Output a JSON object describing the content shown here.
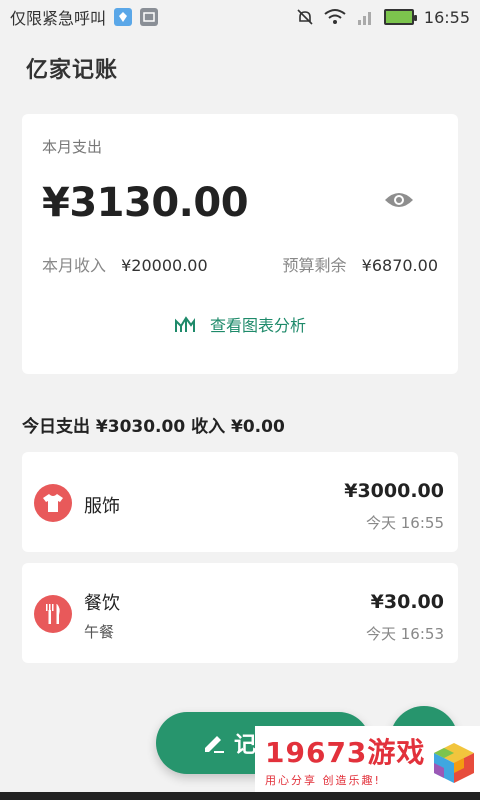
{
  "status_bar": {
    "notification_text": "仅限紧急呼叫",
    "time": "16:55"
  },
  "app_bar": {
    "title": "亿家记账"
  },
  "summary": {
    "month_expense_label": "本月支出",
    "month_expense_amount": "¥3130.00",
    "month_income_label": "本月收入",
    "month_income_amount": "¥20000.00",
    "budget_left_label": "预算剩余",
    "budget_left_amount": "¥6870.00",
    "chart_link_label": "查看图表分析"
  },
  "today": {
    "summary_text": "今日支出 ¥3030.00 收入 ¥0.00"
  },
  "records": [
    {
      "category": "服饰",
      "note": "",
      "amount": "¥3000.00",
      "time": "今天 16:55",
      "icon": "shirt-icon"
    },
    {
      "category": "餐饮",
      "note": "午餐",
      "amount": "¥30.00",
      "time": "今天 16:53",
      "icon": "fork-knife-icon"
    }
  ],
  "fab": {
    "record_label": "记"
  },
  "watermark": {
    "brand": "19673游戏",
    "slogan": "用心分享 创造乐趣!"
  },
  "colors": {
    "accent": "#27956d",
    "link": "#1e8a6a",
    "category_red": "#e8595a",
    "watermark_red": "#e2313b"
  }
}
